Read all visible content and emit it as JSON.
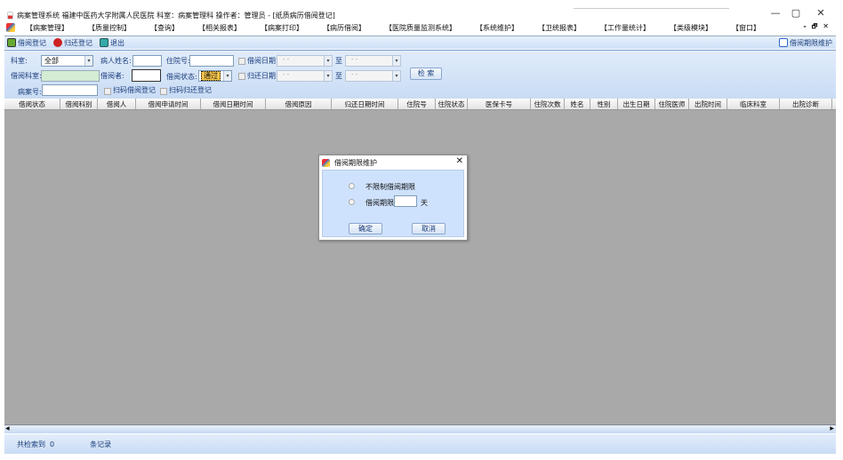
{
  "window": {
    "title": "病案管理系统 福建中医药大学附属人民医院 科室：病案管理科 操作者：管理员 - [纸质病历借阅登记]",
    "minimize": "—",
    "maximize": "▢",
    "close": "✕",
    "mdi_min": "-",
    "mdi_restore": "🗗",
    "mdi_close": "✕"
  },
  "menu": [
    "【病案管理】",
    "【质量控制】",
    "【查询】",
    "【相关报表】",
    "【病案打印】",
    "【病历借阅】",
    "【医院质量监测系统】",
    "【系统维护】",
    "【卫统报表】",
    "【工作量统计】",
    "【类级模块】",
    "【窗口】"
  ],
  "toolbar": {
    "borrow": "借阅登记",
    "return": "归还登记",
    "exit": "退出",
    "limit": "借阅期限维护"
  },
  "filter": {
    "dept_label": "科室:",
    "dept_value": "全部",
    "patient_label": "病人姓名:",
    "inpatient_label": "住院号:",
    "borrow_date_label": "借阅日期:",
    "date_placeholder": "-  -",
    "to": "至",
    "borrow_dept_label": "借阅科室:",
    "borrower_label": "借阅者:",
    "status_label": "借阅状态:",
    "status_value": "通过",
    "return_date_label": "归还日期:",
    "search": "检 索",
    "case_no_label": "病案号:",
    "scan_borrow": "扫码借阅登记",
    "scan_return": "扫码归还登记"
  },
  "columns": [
    "借阅状态",
    "借阅科别",
    "借阅人",
    "借阅申请时间",
    "借阅日期时间",
    "借阅原因",
    "归还日期时间",
    "住院号",
    "住院状态",
    "医保卡号",
    "住院次数",
    "姓名",
    "性别",
    "出生日期",
    "住院医师",
    "出院时间",
    "临床科室",
    "出院诊断"
  ],
  "status": {
    "found_label": "共检索到",
    "count": "0",
    "records": "条记录"
  },
  "dialog": {
    "title": "借阅期限维护",
    "opt_unlimited": "不限制借阅期限",
    "opt_limit": "借阅期限",
    "days_value": "",
    "days_unit": "天",
    "ok": "确定",
    "cancel": "取消"
  }
}
